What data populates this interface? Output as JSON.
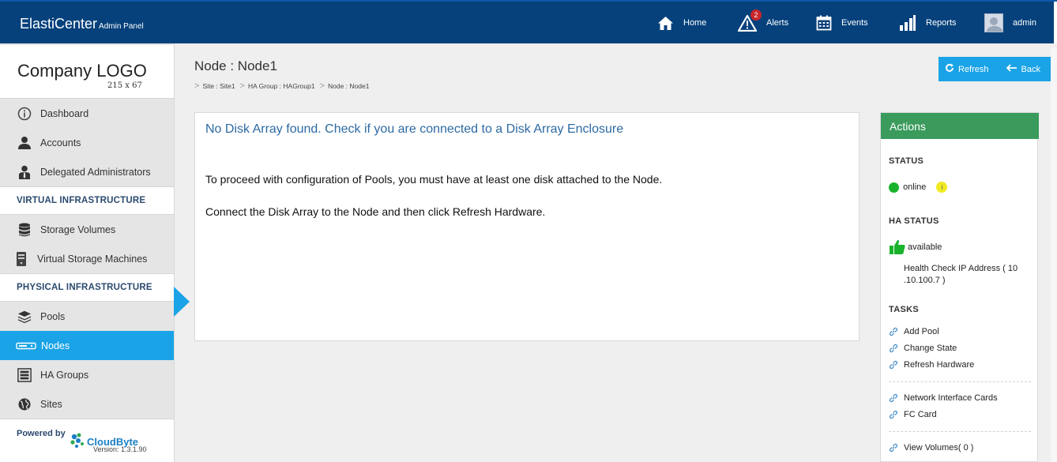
{
  "header": {
    "brand": "ElastiCenter",
    "brand_sub": "Admin Panel",
    "nav": {
      "home": "Home",
      "alerts": "Alerts",
      "alerts_count": "2",
      "events": "Events",
      "reports": "Reports",
      "user": "admin"
    }
  },
  "sidebar": {
    "logo": "Company LOGO",
    "logo_size": "215 x 67",
    "items": [
      {
        "label": "Dashboard"
      },
      {
        "label": "Accounts"
      },
      {
        "label": "Delegated Administrators"
      }
    ],
    "section_virtual": "VIRTUAL INFRASTRUCTURE",
    "virtual_items": [
      {
        "label": "Storage Volumes"
      },
      {
        "label": "Virtual Storage Machines"
      }
    ],
    "section_physical": "PHYSICAL INFRASTRUCTURE",
    "physical_items": [
      {
        "label": "Pools"
      },
      {
        "label": "Nodes"
      },
      {
        "label": "HA Groups"
      },
      {
        "label": "Sites"
      }
    ],
    "powered_by": "Powered by",
    "powered_brand": "CloudByte",
    "version": "Version: 1.3.1.90"
  },
  "main": {
    "title": "Node : Node1",
    "breadcrumb": [
      "Site : Site1",
      "HA Group : HAGroup1",
      "Node : Node1"
    ],
    "refresh_label": "Refresh",
    "back_label": "Back",
    "warning": "No Disk Array found. Check if you are connected to a Disk Array Enclosure",
    "message1": "To proceed with configuration of Pools, you must have at least one disk attached to the Node.",
    "message2": "Connect the Disk Array to the Node and then click Refresh Hardware."
  },
  "actions": {
    "title": "Actions",
    "status_heading": "STATUS",
    "status_value": "online",
    "ha_heading": "HA STATUS",
    "ha_value": "available",
    "health_check_line1": "Health Check IP Address ( 10",
    "health_check_line2": ".10.100.7 )",
    "tasks_heading": "TASKS",
    "tasks_group1": [
      "Add Pool",
      "Change State",
      "Refresh Hardware"
    ],
    "tasks_group2": [
      "Network Interface Cards",
      "FC Card"
    ],
    "tasks_group3": [
      "View Volumes( 0 )"
    ]
  },
  "colors": {
    "topbar": "#06417c",
    "accent": "#1aa3e6",
    "actions_header": "#3a9b5d",
    "status_online": "#19b32b"
  }
}
